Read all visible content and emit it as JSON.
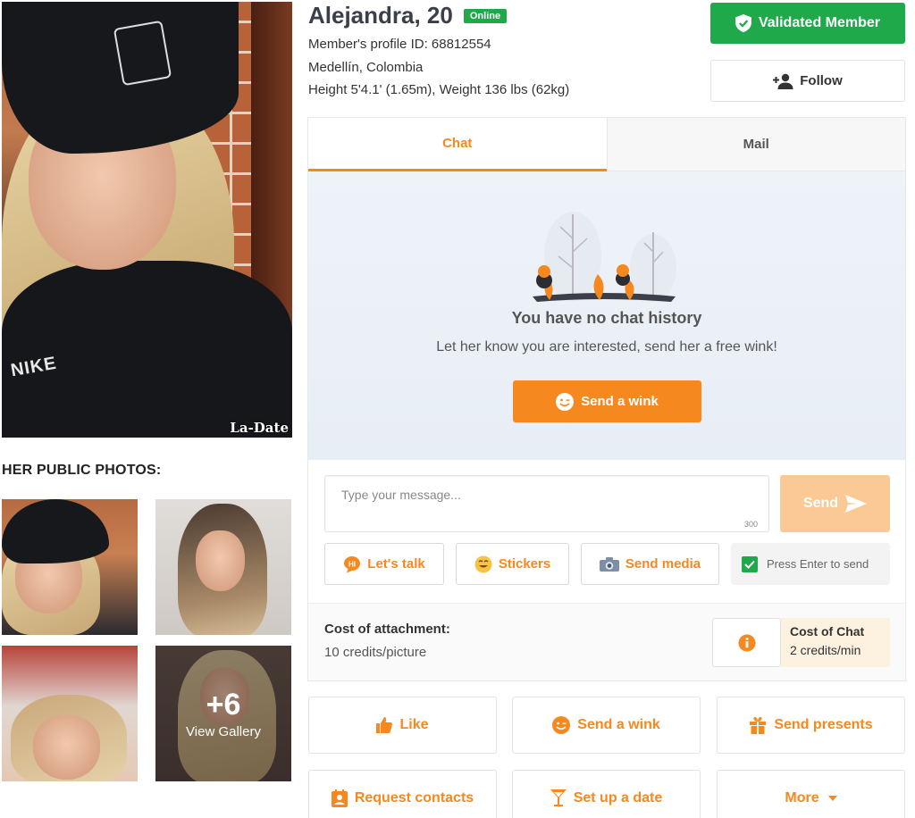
{
  "profile": {
    "name": "Alejandra, 20",
    "status": "Online",
    "profile_id": "Member's profile ID: 68812554",
    "location": "Medellín, Colombia",
    "measurements": "Height 5'4.1' (1.65m), Weight 136 lbs (62kg)",
    "watermark": "La-Date",
    "shirt_text": "NIKE"
  },
  "header_buttons": {
    "validated": "Validated Member",
    "follow": "Follow"
  },
  "photos": {
    "section_title": "HER PUBLIC PHOTOS:",
    "more_count": "+6",
    "view_gallery": "View Gallery"
  },
  "chat": {
    "tabs": [
      {
        "label": "Chat",
        "active": true
      },
      {
        "label": "Mail",
        "active": false
      }
    ],
    "empty_title": "You have no chat history",
    "empty_subtitle": "Let her know you are interested, send her a free wink!",
    "wink_button": "Send a wink",
    "message_placeholder": "Type your message...",
    "char_limit": "300",
    "send_button": "Send",
    "tools": {
      "lets_talk": "Let's talk",
      "stickers": "Stickers",
      "send_media": "Send media",
      "press_enter": "Press Enter to send"
    },
    "cost_attachment_title": "Cost of attachment:",
    "cost_attachment_value": "10 credits/picture",
    "cost_chat_title": "Cost of Chat",
    "cost_chat_value": "2 credits/min"
  },
  "actions": {
    "like": "Like",
    "send_wink": "Send a wink",
    "send_presents": "Send presents",
    "request_contacts": "Request contacts",
    "set_up_date": "Set up a date",
    "more": "More"
  },
  "colors": {
    "accent_orange": "#f5891f",
    "green": "#1fa94a",
    "send_disabled": "#fbc995"
  }
}
